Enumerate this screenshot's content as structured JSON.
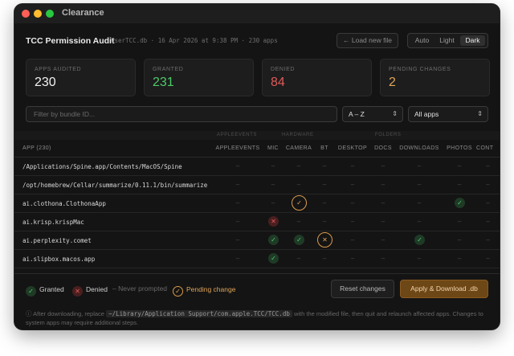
{
  "window": {
    "title": "Clearance"
  },
  "header": {
    "title": "TCC Permission Audit",
    "meta": "UserTCC.db · 16 Apr 2026 at 9:38 PM · 230 apps",
    "load_button": "← Load new file",
    "theme_options": [
      "Auto",
      "Light",
      "Dark"
    ],
    "theme_selected": "Dark"
  },
  "stats": [
    {
      "label": "APPS AUDITED",
      "value": "230",
      "color": "#f2f2f2"
    },
    {
      "label": "GRANTED",
      "value": "231",
      "color": "#4ecb6a"
    },
    {
      "label": "DENIED",
      "value": "84",
      "color": "#e05a5a"
    },
    {
      "label": "PENDING CHANGES",
      "value": "2",
      "color": "#e0a55a"
    }
  ],
  "filters": {
    "search_placeholder": "Filter by bundle ID...",
    "sort_value": "A – Z",
    "scope_value": "All apps"
  },
  "table": {
    "group_labels": [
      "APPLEEVENTS",
      "HARDWARE",
      "FOLDERS"
    ],
    "app_header": "APP (230)",
    "columns": [
      "APPLEEVENTS",
      "MIC",
      "CAMERA",
      "BT",
      "DESKTOP",
      "DOCS",
      "DOWNLOADS",
      "PHOTOS",
      "CONT"
    ],
    "rows": [
      {
        "name": "/Applications/Spine.app/Contents/MacOS/Spine",
        "cells": [
          "-",
          "-",
          "-",
          "-",
          "-",
          "-",
          "-",
          "-",
          "-"
        ]
      },
      {
        "name": "/opt/homebrew/Cellar/summarize/0.11.1/bin/summarize",
        "cells": [
          "-",
          "-",
          "-",
          "-",
          "-",
          "-",
          "-",
          "-",
          "-"
        ]
      },
      {
        "name": "ai.clothona.ClothonaApp",
        "cells": [
          "-",
          "-",
          "P",
          "-",
          "-",
          "-",
          "-",
          "G",
          "-"
        ]
      },
      {
        "name": "ai.krisp.krispMac",
        "cells": [
          "-",
          "D",
          "-",
          "-",
          "-",
          "-",
          "-",
          "-",
          "-"
        ]
      },
      {
        "name": "ai.perplexity.comet",
        "cells": [
          "-",
          "G",
          "G",
          "P",
          "-",
          "-",
          "G",
          "-",
          "-"
        ]
      },
      {
        "name": "ai.slipbox.macos.app",
        "cells": [
          "-",
          "G",
          "-",
          "-",
          "-",
          "-",
          "-",
          "-",
          "-"
        ]
      }
    ]
  },
  "legend": {
    "granted": "Granted",
    "denied": "Denied",
    "never": "– Never prompted",
    "pending": "Pending change"
  },
  "icons": {
    "granted": "✓",
    "denied": "✕",
    "pending": "✓",
    "none": "–"
  },
  "actions": {
    "reset": "Reset changes",
    "apply": "Apply & Download .db"
  },
  "note": {
    "prefix": "ⓘ After downloading, replace",
    "path": "~/Library/Application Support/com.apple.TCC/TCC.db",
    "suffix": "with the modified file, then quit and relaunch affected apps. Changes to system apps may require additional steps."
  }
}
